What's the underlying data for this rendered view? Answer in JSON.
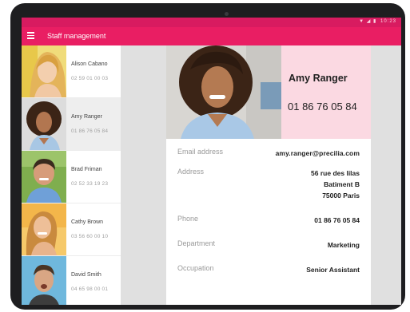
{
  "status_bar": {
    "icons": "▼ ◢ ▮",
    "time": "10:23"
  },
  "app_bar": {
    "title": "Staff management"
  },
  "staff_list": [
    {
      "name": "Alison Cabano",
      "phone": "02 59 01 00 03"
    },
    {
      "name": "Amy Ranger",
      "phone": "01 86 76 05 84"
    },
    {
      "name": "Brad Friman",
      "phone": "02 52 33 19 23"
    },
    {
      "name": "Cathy Brown",
      "phone": "03 56 60 00 10"
    },
    {
      "name": "David Smith",
      "phone": "04 65 98 00 01"
    }
  ],
  "selected_index": 1,
  "detail": {
    "name": "Amy Ranger",
    "phone": "01 86 76 05 84",
    "email_label": "Email address",
    "email": "amy.ranger@precilia.com",
    "address_label": "Address",
    "address_line1": "56 rue des lilas",
    "address_line2": "Batiment B",
    "address_line3": "75000 Paris",
    "phone_label": "Phone",
    "phone_value": "01 86 76 05 84",
    "department_label": "Department",
    "department": "Marketing",
    "occupation_label": "Occupation",
    "occupation": "Senior Assistant"
  },
  "colors": {
    "status_bar": "#d81b60",
    "app_bar": "#e91e63",
    "header_background": "#fbd9e2",
    "gutter": "#e0e0e0"
  }
}
